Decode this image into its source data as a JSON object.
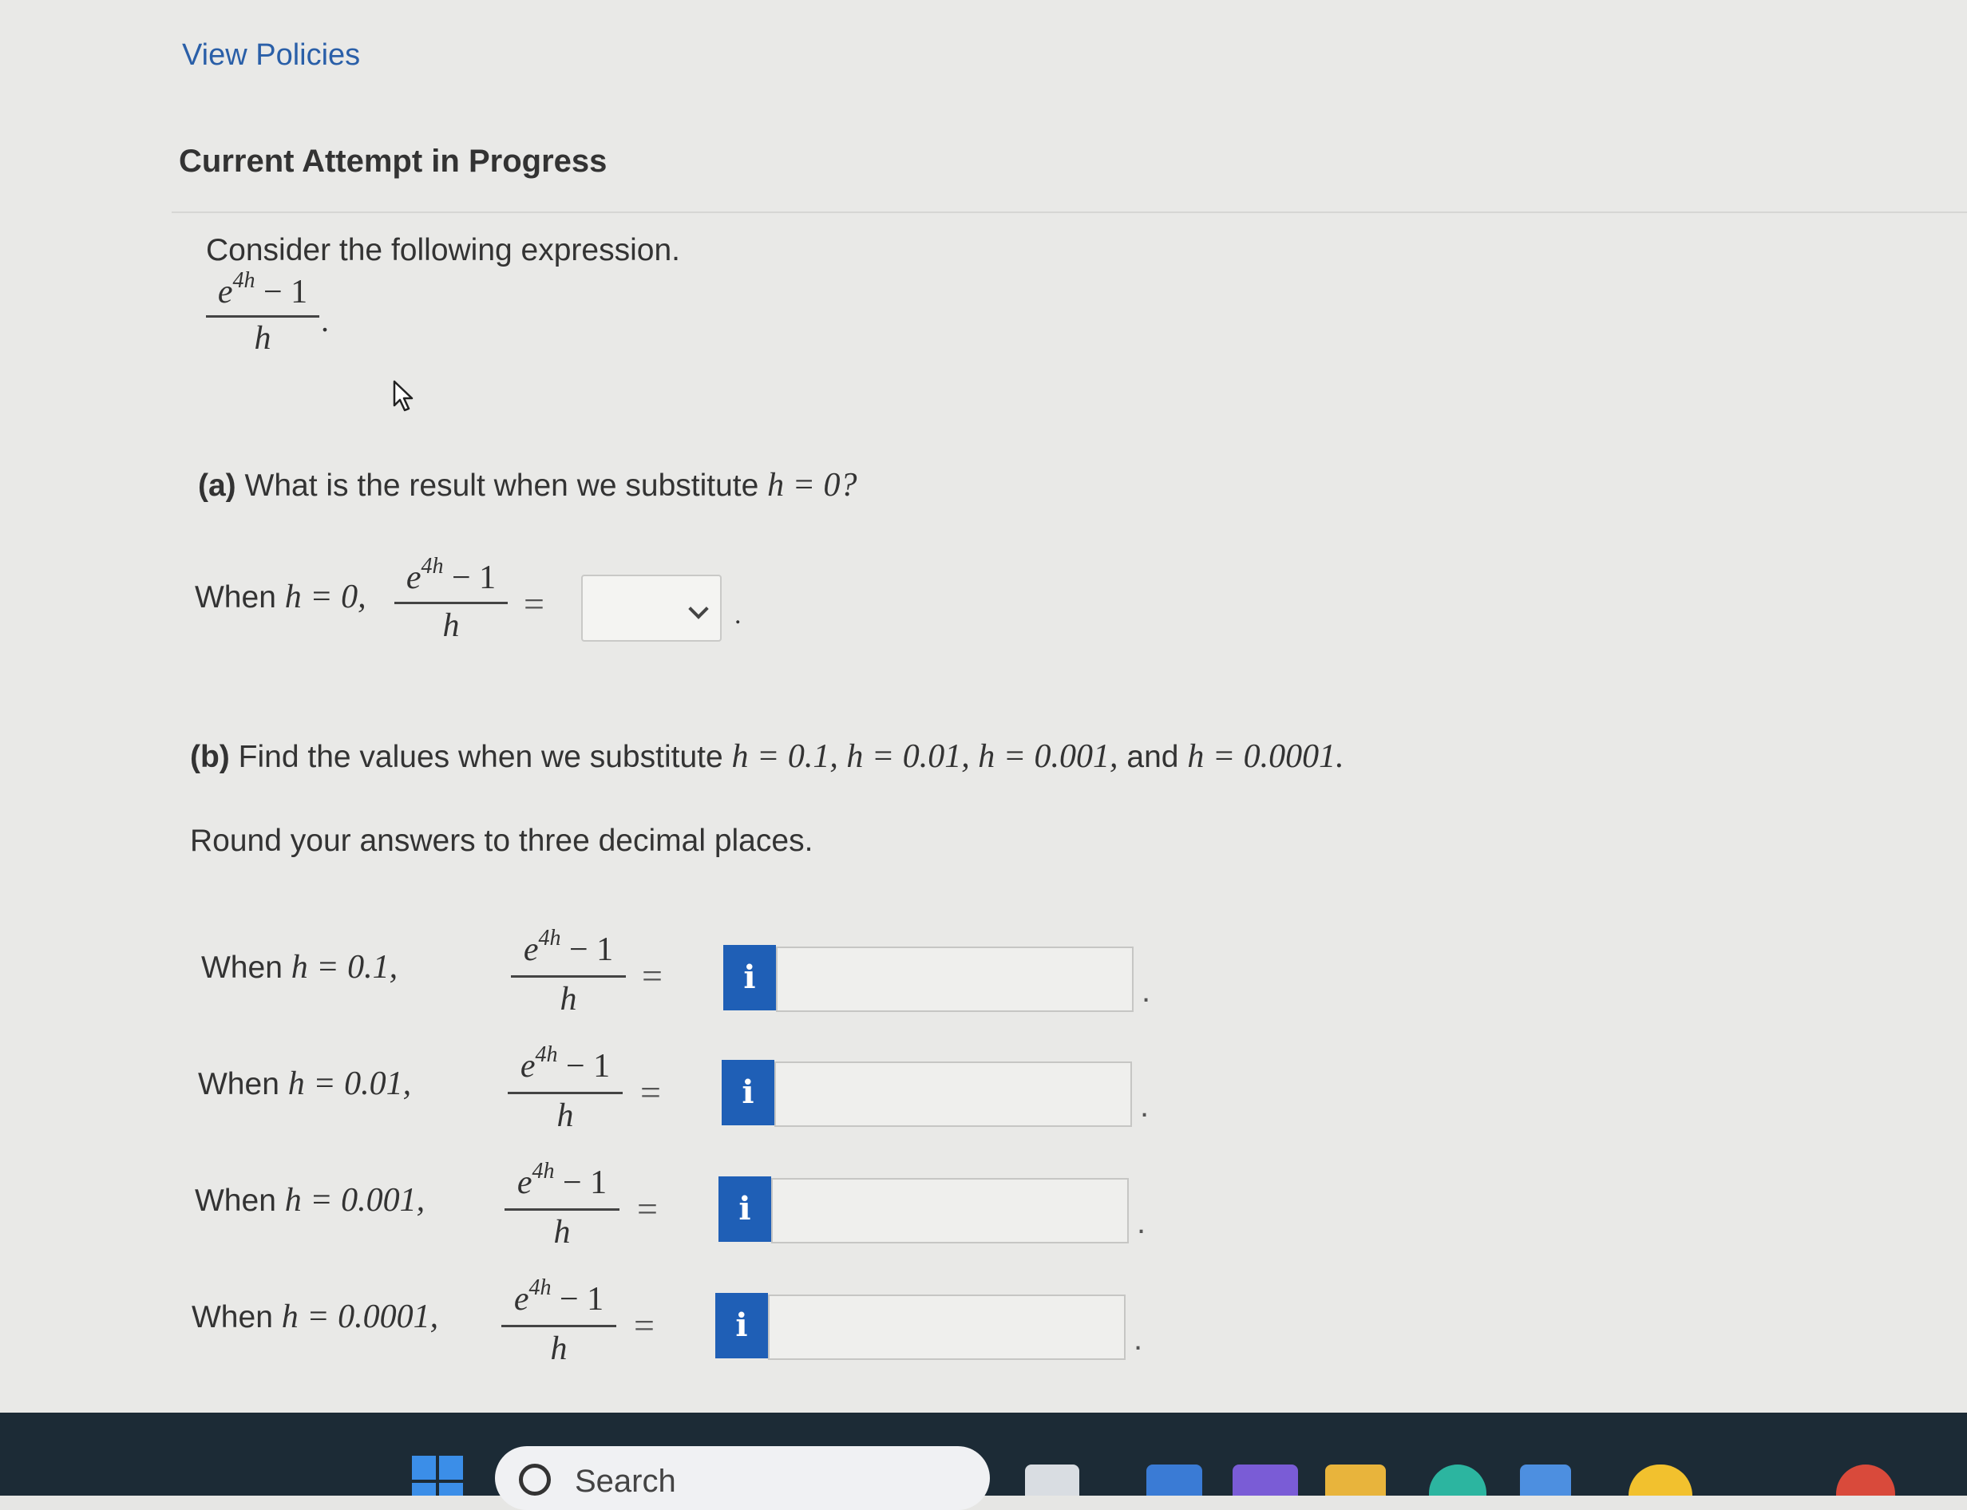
{
  "nav": {
    "view_policies": "View Policies"
  },
  "heading": "Current Attempt in Progress",
  "intro": "Consider the following expression.",
  "expression": {
    "base": "e",
    "exponent": "4h",
    "minus_one": " − 1",
    "denominator": "h",
    "trailing": "."
  },
  "part_a": {
    "label": "(a)",
    "question": "What is the result when we substitute",
    "condition": "h = 0?",
    "when_text": "When",
    "when_math": "h = 0,",
    "select_value": "",
    "trailing": "."
  },
  "part_b": {
    "label": "(b)",
    "question": "Find the values when we substitute",
    "conditions": "h = 0.1, h = 0.01, h = 0.001,",
    "and_text": "and",
    "last_condition": "h = 0.0001.",
    "round_note": "Round your answers to three decimal places.",
    "rows": [
      {
        "when_text": "When",
        "when_math": "h = 0.1,",
        "info_label": "i",
        "value": ""
      },
      {
        "when_text": "When",
        "when_math": "h = 0.01,",
        "info_label": "i",
        "value": ""
      },
      {
        "when_text": "When",
        "when_math": "h = 0.001,",
        "info_label": "i",
        "value": ""
      },
      {
        "when_text": "When",
        "when_math": "h = 0.0001,",
        "info_label": "i",
        "value": ""
      }
    ]
  },
  "equals": "=",
  "taskbar": {
    "search_placeholder": "Search"
  },
  "colors": {
    "info_button": "#1f5fb6",
    "link": "#2a5fa8",
    "taskbar": "#1c2b36"
  }
}
